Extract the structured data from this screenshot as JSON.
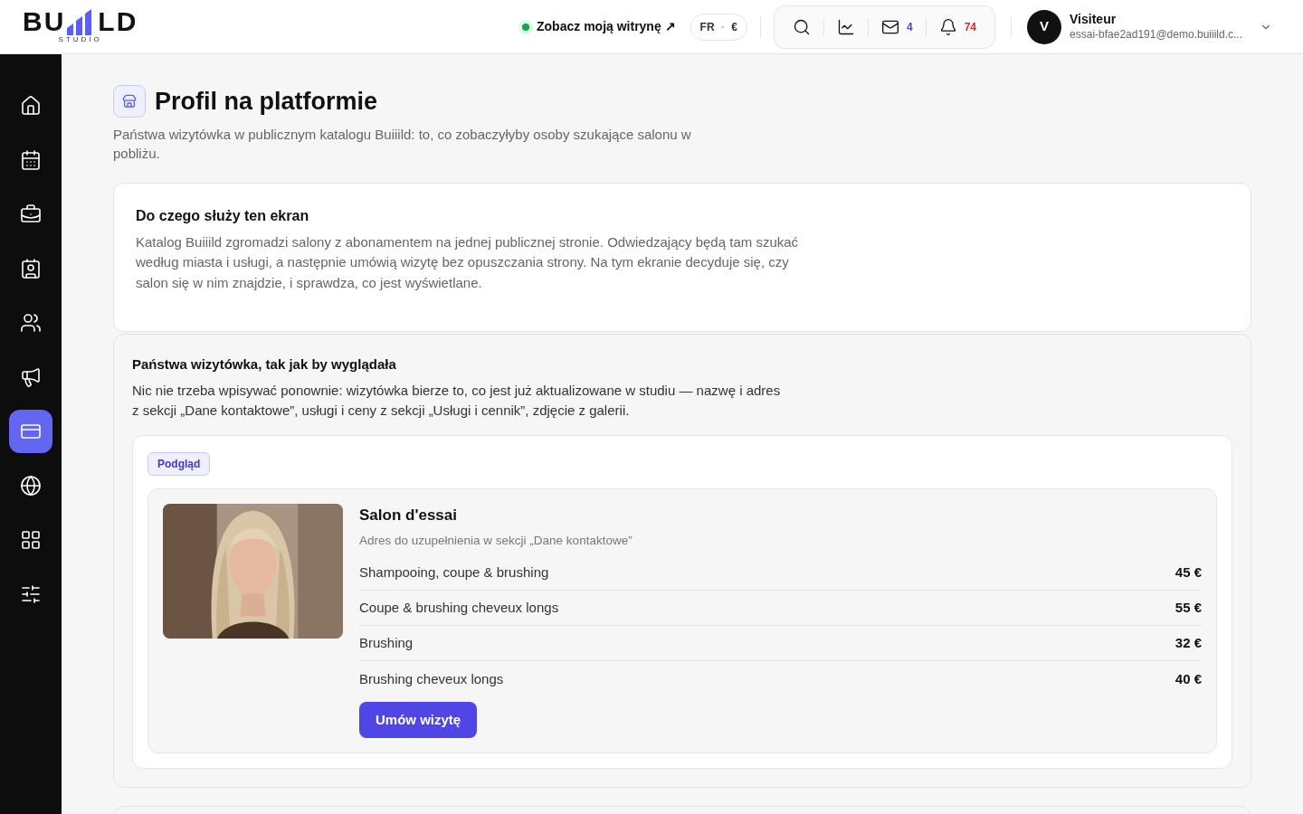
{
  "header": {
    "logo": {
      "left": "BU",
      "right": "LD",
      "sub": "STUDIO"
    },
    "site_link": {
      "label": "Zobacz moją witrynę ↗",
      "online": true
    },
    "locale": {
      "language": "FR",
      "separator": "·",
      "currency": "€"
    },
    "toolbar": [
      {
        "kind": "search"
      },
      {
        "kind": "stats"
      },
      {
        "kind": "mail",
        "count": "4"
      },
      {
        "kind": "bell",
        "count": "74"
      }
    ],
    "user": {
      "initial": "V",
      "name": "Visiteur",
      "email": "essai-bfae2ad191@demo.buiiild.c..."
    }
  },
  "sidebar": {
    "items": [
      {
        "kind": "home",
        "selected": false
      },
      {
        "kind": "calendar",
        "selected": false
      },
      {
        "kind": "toolbox",
        "selected": false
      },
      {
        "kind": "contact",
        "selected": false
      },
      {
        "kind": "users",
        "selected": false
      },
      {
        "kind": "megaphone",
        "selected": false
      },
      {
        "kind": "card",
        "selected": true
      },
      {
        "kind": "globe",
        "selected": false
      },
      {
        "kind": "apps",
        "selected": false
      },
      {
        "kind": "sliders",
        "selected": false
      }
    ]
  },
  "page": {
    "title": "Profil na platformie",
    "subtitle": "Państwa wizytówka w publicznym katalogu Buiiild: to, co zobaczyłyby osoby szukające salonu w pobliżu."
  },
  "intro_card": {
    "title": "Do czego służy ten ekran",
    "text": "Katalog Buiiild zgromadzi salony z abonamentem na jednej publicznej stronie. Odwiedzający będą tam szukać według miasta i usługi, a następnie umówią wizytę bez opuszczania strony. Na tym ekranie decyduje się, czy salon się w nim znajdzie, i sprawdza, co jest wyświetlane."
  },
  "preview_section": {
    "title": "Państwa wizytówka, tak jak by wyglądała",
    "text": "Nic nie trzeba wpisywać ponownie: wizytówka bierze to, co jest już aktualizowane w studiu — nazwę i adres z sekcji „Dane kontaktowe”, usługi i ceny z sekcji „Usługi i cennik”, zdjęcie z galerii.",
    "badge": "Podgląd",
    "listing": {
      "name": "Salon d'essai",
      "address": "Adres do uzupełnienia w sekcji „Dane kontaktowe”",
      "services": [
        {
          "name": "Shampooing, coupe & brushing",
          "price": "45 €"
        },
        {
          "name": "Coupe & brushing cheveux longs",
          "price": "55 €"
        },
        {
          "name": "Brushing",
          "price": "32 €"
        },
        {
          "name": "Brushing cheveux longs",
          "price": "40 €"
        }
      ],
      "button": "Umów wizytę"
    }
  }
}
